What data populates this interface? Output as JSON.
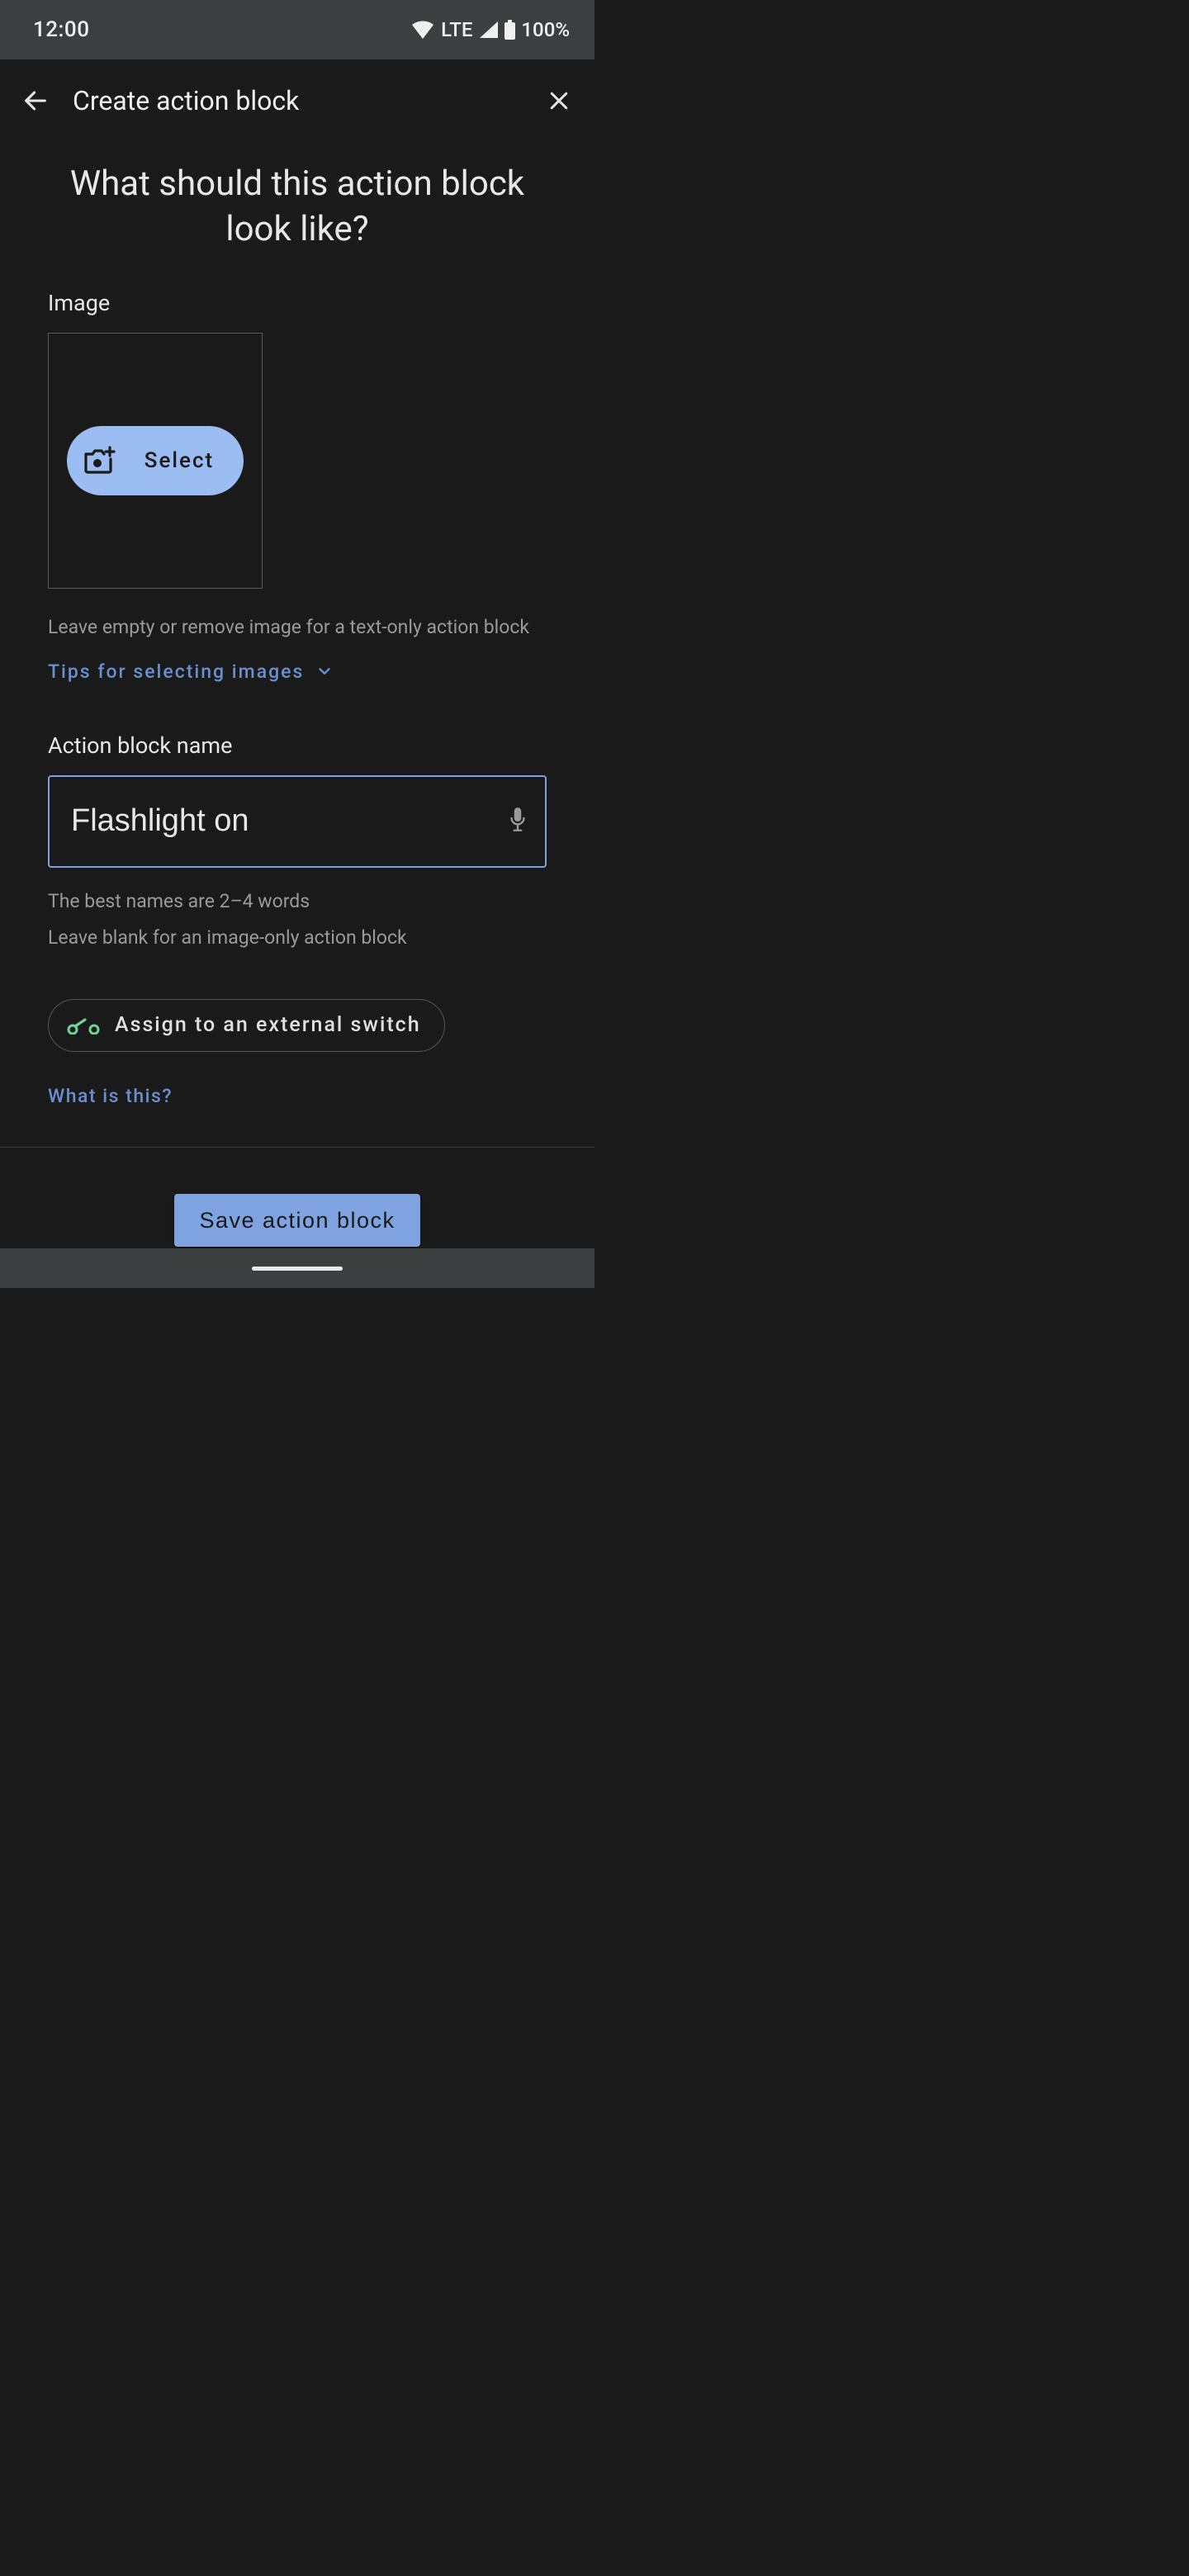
{
  "status": {
    "time": "12:00",
    "network_label": "LTE",
    "battery": "100%"
  },
  "appbar": {
    "title": "Create action block"
  },
  "page": {
    "heading": "What should this action block look like?"
  },
  "image_section": {
    "label": "Image",
    "select_button": "Select",
    "hint": "Leave empty or remove image for a text-only action block",
    "tips_link": "Tips for selecting images"
  },
  "name_section": {
    "label": "Action block name",
    "value": "Flashlight on",
    "hint1": "The best names are 2–4 words",
    "hint2": "Leave blank for an image-only action block"
  },
  "switch": {
    "assign_label": "Assign to an external switch",
    "help_link": "What is this?"
  },
  "footer": {
    "save": "Save action block"
  }
}
